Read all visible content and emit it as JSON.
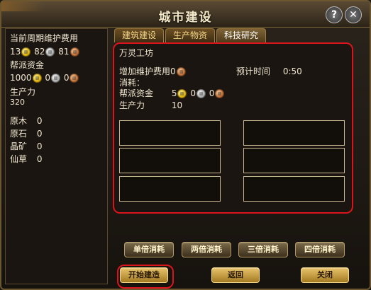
{
  "window": {
    "title": "城市建设"
  },
  "tabs": [
    {
      "label": "建筑建设"
    },
    {
      "label": "生产物资"
    },
    {
      "label": "科技研究"
    }
  ],
  "left_panel": {
    "maintenance_label": "当前周期维护费用",
    "maintenance": {
      "gold": "13",
      "silver": "82",
      "copper": "81"
    },
    "faction_funds_label": "帮派资金",
    "faction_funds": {
      "gold": "1000",
      "silver": "0",
      "copper": "0"
    },
    "productivity_label": "生产力",
    "productivity_value": "320",
    "resources": [
      {
        "name": "原木",
        "value": "0"
      },
      {
        "name": "原石",
        "value": "0"
      },
      {
        "name": "晶矿",
        "value": "0"
      },
      {
        "name": "仙草",
        "value": "0"
      }
    ]
  },
  "detail": {
    "building_name": "万灵工坊",
    "add_maintenance_label": "增加维护费用",
    "add_maintenance_value": "0",
    "time_label": "预计时间",
    "time_value": "0:50",
    "consume_label": "消耗：",
    "funds_label": "帮派资金",
    "funds": {
      "gold": "5",
      "silver": "0",
      "copper": "0"
    },
    "productivity_label": "生产力",
    "productivity_value": "10"
  },
  "buttons": {
    "single": "单倍消耗",
    "double": "两倍消耗",
    "triple": "三倍消耗",
    "quad": "四倍消耗",
    "start": "开始建造",
    "back": "返回",
    "close": "关闭"
  },
  "colors": {
    "highlight": "#d9141c",
    "accent": "#c9a24a"
  }
}
